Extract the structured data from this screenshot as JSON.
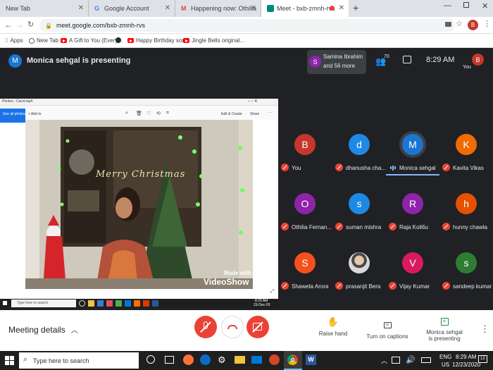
{
  "tabs": [
    {
      "label": "New Tab"
    },
    {
      "label": "Google Account"
    },
    {
      "label": "Happening now: Othilia Fernande"
    },
    {
      "label": "Meet - bxb-zmnh-rvs"
    }
  ],
  "address": {
    "url": "meet.google.com/bxb-zmnh-rvs"
  },
  "bookmarks": [
    {
      "label": "Apps"
    },
    {
      "label": "New Tab"
    },
    {
      "label": "A Gift to You (Every..."
    },
    {
      "label": "Happy Birthday son..."
    },
    {
      "label": "Jingle Bells original..."
    }
  ],
  "profile": {
    "initial": "B"
  },
  "meet": {
    "presenter_initial": "M",
    "presenting_text": "Monica sehgal is presenting",
    "others": {
      "initial": "S",
      "line1": "Samina Ibrahim",
      "line2": "and 56 more"
    },
    "people_count": "70",
    "time": "8:29 AM",
    "self_label": "You",
    "self_initial": "B"
  },
  "participants": [
    {
      "initial": "B",
      "name": "You",
      "color": "#c5372c",
      "muted": true
    },
    {
      "initial": "d",
      "name": "dhanusha cha...",
      "color": "#1e88e5",
      "muted": true
    },
    {
      "initial": "M",
      "name": "Monica sehgal",
      "color": "#1976d2",
      "muted": false
    },
    {
      "initial": "K",
      "name": "Kavita Vikas",
      "color": "#ef6c00",
      "muted": true
    },
    {
      "initial": "O",
      "name": "Othilia Fernan...",
      "color": "#8e24aa",
      "muted": true
    },
    {
      "initial": "s",
      "name": "suman mishra",
      "color": "#1e88e5",
      "muted": true
    },
    {
      "initial": "R",
      "name": "Raja Koli6u",
      "color": "#8e24aa",
      "muted": true
    },
    {
      "initial": "h",
      "name": "hunny chawla",
      "color": "#e65100",
      "muted": true
    },
    {
      "initial": "S",
      "name": "Shaweta Arora",
      "color": "#f4511e",
      "muted": true
    },
    {
      "initial": "",
      "name": "prasanjit Bera",
      "color": "#8d8d8d",
      "muted": true
    },
    {
      "initial": "V",
      "name": "Vijay Kumar",
      "color": "#d81b60",
      "muted": true
    },
    {
      "initial": "s",
      "name": "sandeep kumar",
      "color": "#2e7d32",
      "muted": true
    }
  ],
  "shared": {
    "window_title": "Photos - Carol.mp4",
    "side_label": "See all photos",
    "add_label": "+ Add to",
    "edit_label": "Edit & Create",
    "share_label": "Share",
    "watermark_line1": "Made with",
    "watermark_line2": "VideoShow",
    "banner_text": "Merry Christmas",
    "inner_search": "Type here to search",
    "inner_time": "8:29 AM",
    "inner_date": "23-Dec-20"
  },
  "controls": {
    "meeting_details": "Meeting details",
    "raise_hand": "Raise hand",
    "captions": "Turn on captions",
    "presenting_line1": "Monica sehgal",
    "presenting_line2": "is presenting"
  },
  "taskbar": {
    "search_placeholder": "Type here to search",
    "lang1": "ENG",
    "lang2": "US",
    "time": "8:29 AM",
    "date": "12/23/2020",
    "notif_count": "12"
  },
  "colors": {
    "meet_bg": "#202124",
    "danger": "#ea4335",
    "speaking_accent": "#8ab4f8"
  }
}
